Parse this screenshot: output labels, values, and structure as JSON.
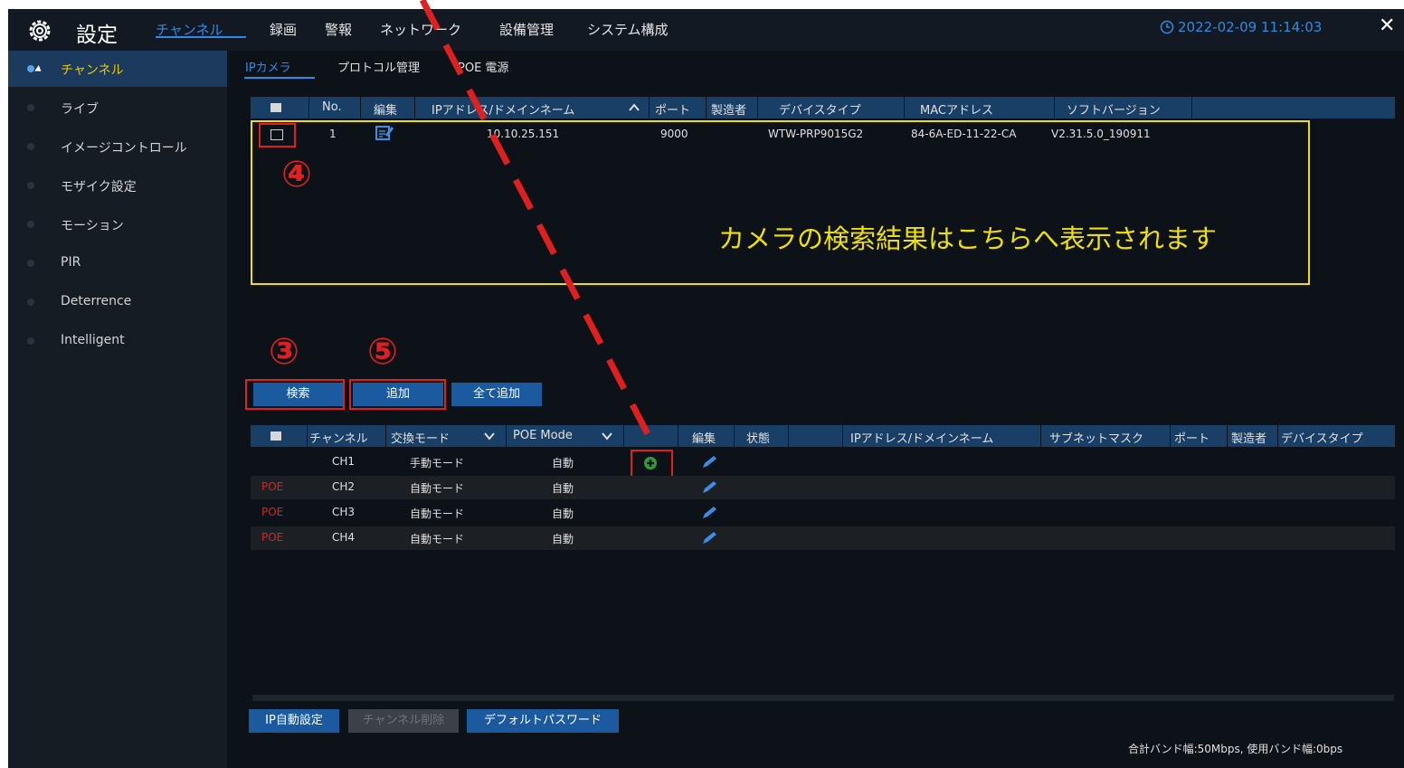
{
  "header": {
    "title": "設定",
    "nav_tabs": [
      "チャンネル",
      "録画",
      "警報",
      "ネットワーク",
      "設備管理",
      "システム構成"
    ],
    "datetime": "2022-02-09 11:14:03",
    "close_glyph": "✕"
  },
  "sidebar": {
    "items": [
      "チャンネル",
      "ライブ",
      "イメージコントロール",
      "モザイク設定",
      "モーション",
      "PIR",
      "Deterrence",
      "Intelligent"
    ]
  },
  "subtabs": [
    "IPカメラ",
    "プロトコル管理",
    "POE 電源"
  ],
  "search_table": {
    "headers": [
      "No.",
      "編集",
      "IPアドレス/ドメインネーム",
      "ポート",
      "製造者",
      "デバイスタイプ",
      "MACアドレス",
      "ソフトバージョン"
    ],
    "rows": [
      {
        "no": "1",
        "ip": "10.10.25.151",
        "port": "9000",
        "device_type": "WTW-PRP9015G2",
        "mac": "84-6A-ED-11-22-CA",
        "software": "V2.31.5.0_190911"
      }
    ]
  },
  "annotation": {
    "caption": "カメラの検索結果はこちらへ表示されます",
    "step3": "③",
    "step4": "④",
    "step5": "⑤"
  },
  "buttons": {
    "search": "検索",
    "add": "追加",
    "add_all": "全て追加",
    "ip_auto": "IP自動設定",
    "delete_channel": "チャンネル削除",
    "default_password": "デフォルトパスワード"
  },
  "channel_table": {
    "headers": [
      "チャンネル",
      "交換モード",
      "POE Mode",
      "編集",
      "状態",
      "IPアドレス/ドメインネーム",
      "サブネットマスク",
      "ポート",
      "製造者",
      "デバイスタイプ"
    ],
    "rows": [
      {
        "poe": "",
        "channel": "CH1",
        "mode": "手動モード",
        "poe_mode": "自動"
      },
      {
        "poe": "POE",
        "channel": "CH2",
        "mode": "自動モード",
        "poe_mode": "自動"
      },
      {
        "poe": "POE",
        "channel": "CH3",
        "mode": "自動モード",
        "poe_mode": "自動"
      },
      {
        "poe": "POE",
        "channel": "CH4",
        "mode": "自動モード",
        "poe_mode": "自動"
      }
    ]
  },
  "footer": {
    "bandwidth": "合計バンド幅:50Mbps, 使用バンド幅:0bps"
  },
  "colors": {
    "accent": "#2b8ce8",
    "highlight_red": "#e02020",
    "annotation_yellow": "#f0e000",
    "header_row": "#1a3f66"
  }
}
